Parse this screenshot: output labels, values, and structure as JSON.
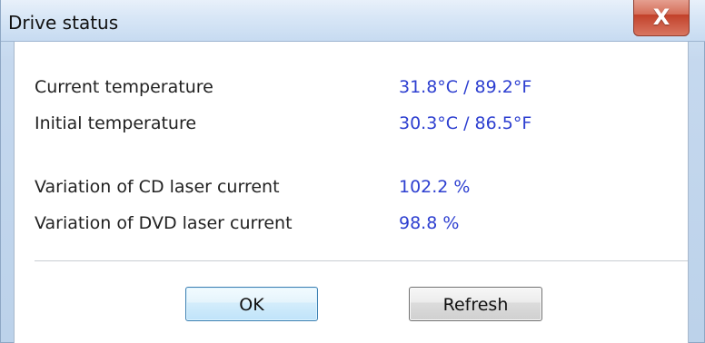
{
  "window": {
    "title": "Drive status",
    "close_label": "X"
  },
  "status": {
    "rows": [
      {
        "label": "Current temperature",
        "value": "31.8°C / 89.2°F"
      },
      {
        "label": "Initial temperature",
        "value": "30.3°C / 86.5°F"
      },
      {
        "label": "Variation of CD laser current",
        "value": "102.2 %"
      },
      {
        "label": "Variation of DVD laser current",
        "value": "98.8 %"
      }
    ]
  },
  "buttons": {
    "ok_label": "OK",
    "refresh_label": "Refresh"
  },
  "colors": {
    "value_text": "#2d3fd0",
    "close_button": "#c2412a",
    "ok_border": "#3c7fb1"
  },
  "icons": {
    "close": "close-icon"
  }
}
